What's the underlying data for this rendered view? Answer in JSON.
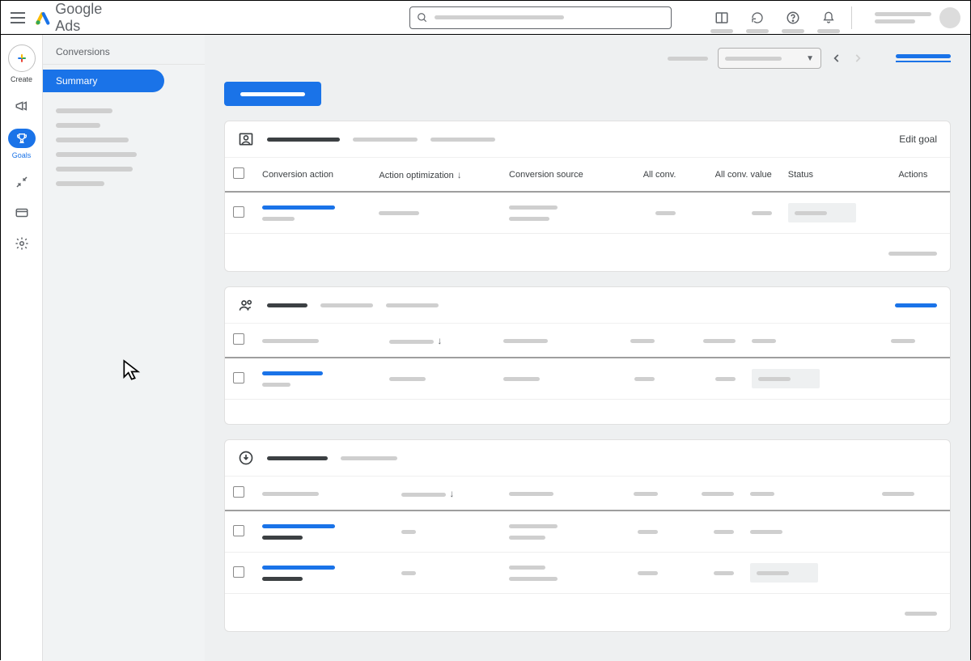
{
  "header": {
    "app_name": "Google",
    "app_suffix": "Ads"
  },
  "rail": {
    "create": "Create",
    "goals": "Goals"
  },
  "secnav": {
    "section": "Conversions",
    "active": "Summary"
  },
  "table": {
    "headers": {
      "action": "Conversion action",
      "opt": "Action optimization",
      "source": "Conversion source",
      "all_conv": "All conv.",
      "all_conv_val": "All conv. value",
      "status": "Status",
      "actions": "Actions"
    },
    "card1_link": "Edit goal"
  }
}
